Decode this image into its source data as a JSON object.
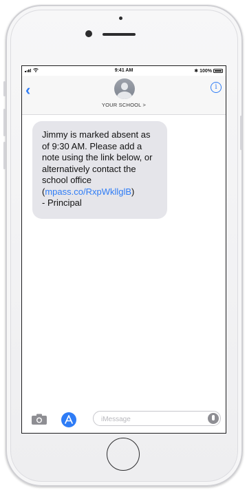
{
  "status_bar": {
    "carrier_icons": [
      "signal-icon",
      "wifi-icon"
    ],
    "time": "9:41 AM",
    "battery": "✱ 100%"
  },
  "header": {
    "back_icon": "chevron-left-icon",
    "contact_name": "YOUR SCHOOL >",
    "info_icon": "info-icon",
    "info_glyph": "i"
  },
  "message": {
    "text": "Jimmy is marked absent as of 9:30 AM. Please add a note using the link below, or alternatively contact the school office (",
    "link": "mpass.co/RxpWkllglB",
    "text_after_link": ")",
    "signature": "- Principal"
  },
  "input_bar": {
    "placeholder": "iMessage",
    "value": ""
  },
  "colors": {
    "accent": "#2e7cf6",
    "bubble": "#e5e5ea"
  }
}
